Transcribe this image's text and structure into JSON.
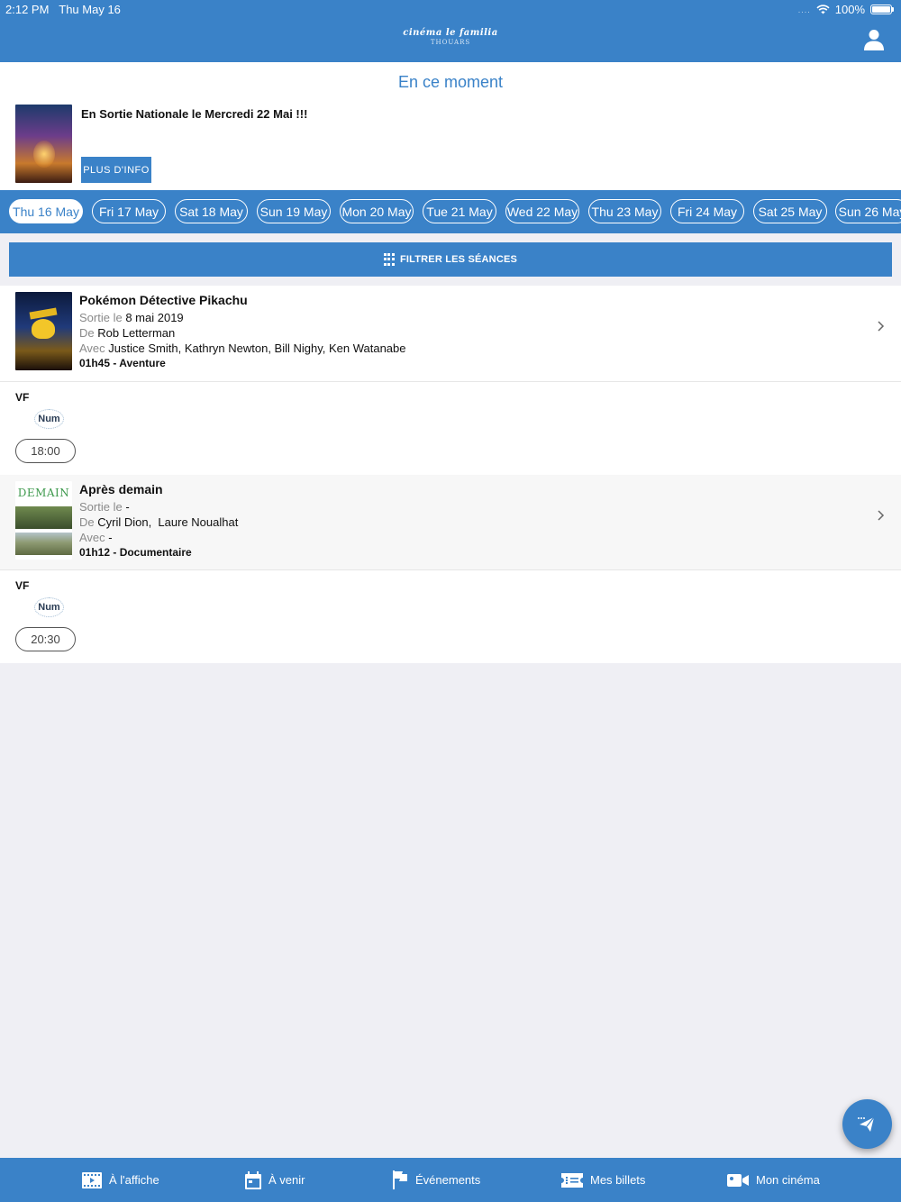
{
  "status_bar": {
    "time": "2:12 PM",
    "date": "Thu May 16",
    "signal": "....",
    "battery": "100%"
  },
  "header": {
    "logo_main": "cinéma le familia",
    "logo_sub": "THOUARS"
  },
  "featured": {
    "heading": "En ce moment",
    "text": "En Sortie Nationale le Mercredi 22 Mai !!!",
    "button": "PLUS D'INFO"
  },
  "dates": [
    "Thu 16 May",
    "Fri 17 May",
    "Sat 18 May",
    "Sun 19 May",
    "Mon 20 May",
    "Tue 21 May",
    "Wed 22 May",
    "Thu 23 May",
    "Fri 24 May",
    "Sat 25 May",
    "Sun 26 May"
  ],
  "selected_date": "Thu 16 May",
  "filter": {
    "label": "FILTRER LES SÉANCES"
  },
  "movies": [
    {
      "title": "Pokémon Détective Pikachu",
      "release_label": "Sortie le",
      "release": "8 mai 2019",
      "director_label": "De",
      "director": "Rob Letterman",
      "cast_label": "Avec",
      "cast": "Justice Smith, Kathryn Newton, Bill Nighy, Ken Watanabe",
      "meta": "01h45 - Aventure",
      "language": "VF",
      "format": "Num",
      "times": [
        "18:00"
      ]
    },
    {
      "title": "Après demain",
      "release_label": "Sortie le",
      "release": "-",
      "director_label": "De",
      "director": "Cyril Dion,  Laure Noualhat",
      "cast_label": "Avec",
      "cast": "-",
      "meta": "01h12 - Documentaire",
      "language": "VF",
      "format": "Num",
      "times": [
        "20:30"
      ],
      "poster_title": "DEMAIN"
    }
  ],
  "tabs": [
    {
      "label": "À l'affiche",
      "icon": "film-icon"
    },
    {
      "label": "À venir",
      "icon": "calendar-icon"
    },
    {
      "label": "Événements",
      "icon": "flag-icon"
    },
    {
      "label": "Mes billets",
      "icon": "ticket-icon"
    },
    {
      "label": "Mon cinéma",
      "icon": "camera-icon"
    }
  ],
  "colors": {
    "primary": "#3a82c8",
    "background": "#efeff4"
  }
}
